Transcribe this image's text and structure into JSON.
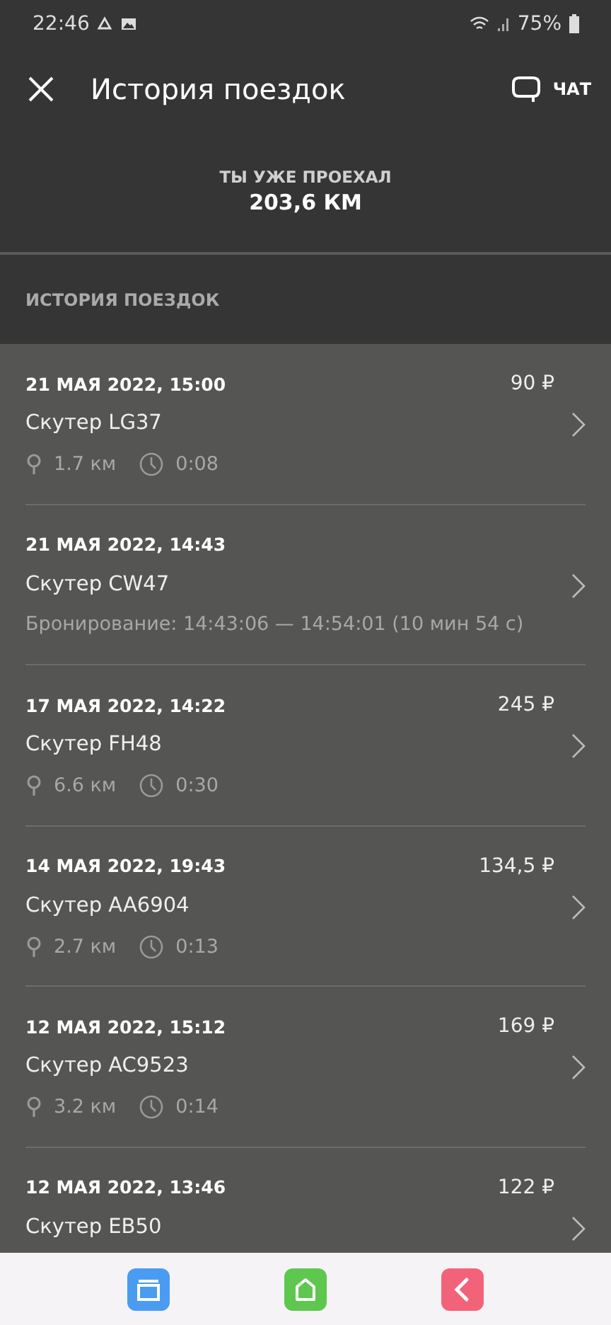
{
  "status_bar": {
    "time": "22:46",
    "battery": "75%"
  },
  "header": {
    "title": "История поездок",
    "chat_label": "ЧАТ"
  },
  "summary": {
    "label": "ТЫ УЖЕ ПРОЕХАЛ",
    "value": "203,6 КМ"
  },
  "section_title": "ИСТОРИЯ ПОЕЗДОК",
  "trips": [
    {
      "kind": "ride",
      "date": "21 МАЯ 2022, 15:00",
      "price": "90 ₽",
      "vehicle": "Скутер LG37",
      "distance": "1.7 км",
      "duration": "0:08"
    },
    {
      "kind": "booking",
      "date": "21 МАЯ 2022, 14:43",
      "vehicle": "Скутер CW47",
      "booking": "Бронирование: 14:43:06 — 14:54:01 (10 мин 54 с)"
    },
    {
      "kind": "ride",
      "date": "17 МАЯ 2022, 14:22",
      "price": "245 ₽",
      "vehicle": "Скутер FH48",
      "distance": "6.6 км",
      "duration": "0:30"
    },
    {
      "kind": "ride",
      "date": "14 МАЯ 2022, 19:43",
      "price": "134,5 ₽",
      "vehicle": "Скутер AA6904",
      "distance": "2.7 км",
      "duration": "0:13"
    },
    {
      "kind": "ride",
      "date": "12 МАЯ 2022, 15:12",
      "price": "169 ₽",
      "vehicle": "Скутер AC9523",
      "distance": "3.2 км",
      "duration": "0:14"
    },
    {
      "kind": "ride",
      "date": "12 МАЯ 2022, 13:46",
      "price": "122 ₽",
      "vehicle": "Скутер EB50"
    }
  ]
}
